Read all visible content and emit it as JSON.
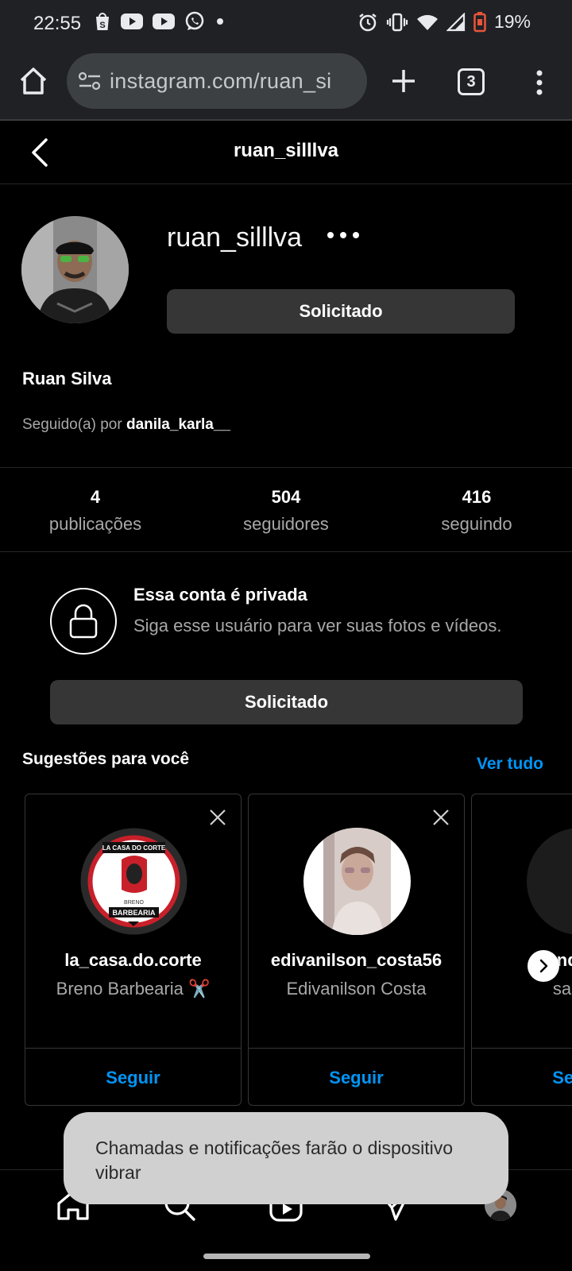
{
  "status_bar": {
    "time": "22:55",
    "battery_pct": "19%",
    "left_icons": [
      "shopee-icon",
      "youtube-icon",
      "youtube-icon",
      "whatsapp-icon",
      "dot-icon"
    ],
    "right_icons": [
      "alarm-icon",
      "vibrate-icon",
      "wifi-icon",
      "signal-icon",
      "battery-low-icon"
    ]
  },
  "browser": {
    "url": "instagram.com/ruan_si",
    "tab_count": "3"
  },
  "header": {
    "title": "ruan_silllva"
  },
  "profile": {
    "username": "ruan_silllva",
    "request_button": "Solicitado",
    "full_name": "Ruan Silva",
    "followed_by_prefix": "Seguido(a) por ",
    "followed_by_user": "danila_karla__"
  },
  "stats": [
    {
      "value": "4",
      "label": "publicações"
    },
    {
      "value": "504",
      "label": "seguidores"
    },
    {
      "value": "416",
      "label": "seguindo"
    }
  ],
  "private": {
    "title": "Essa conta é privada",
    "description": "Siga esse usuário para ver suas fotos e vídeos.",
    "button": "Solicitado"
  },
  "suggestions": {
    "title": "Sugestões para você",
    "see_all": "Ver tudo",
    "cards": [
      {
        "username": "la_casa.do.corte",
        "name": "Breno Barbearia ✂️",
        "follow": "Seguir",
        "logo_top": "LA CASA DO CORTE",
        "logo_mid": "BRENO",
        "logo_bottom": "BARBEARIA"
      },
      {
        "username": "edivanilson_costa56",
        "name": "Edivanilson Costa",
        "follow": "Seguir"
      },
      {
        "username": "sandro_ot",
        "name": "sandro",
        "follow": "Seguir"
      }
    ]
  },
  "toast": {
    "text": "Chamadas e notificações farão o dispositivo vibrar"
  },
  "colors": {
    "accent": "#0095f6",
    "background": "#000000",
    "button_gray": "#363636",
    "chrome_bar": "#202124"
  }
}
